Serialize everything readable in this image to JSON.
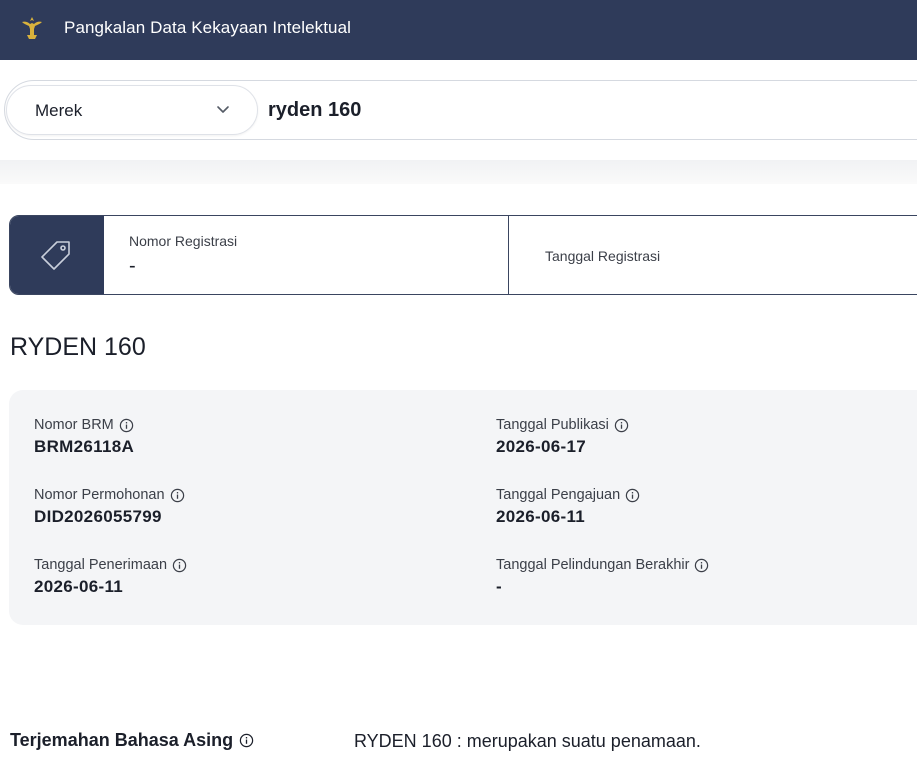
{
  "header": {
    "title": "Pangkalan Data Kekayaan Intelektual"
  },
  "search": {
    "category": "Merek",
    "query": "ryden 160"
  },
  "registration": {
    "number_label": "Nomor Registrasi",
    "number_value": "-",
    "date_label": "Tanggal Registrasi"
  },
  "mark_title": "RYDEN 160",
  "details": {
    "brm_label": "Nomor BRM",
    "brm_value": "BRM26118A",
    "application_label": "Nomor Permohonan",
    "application_value": "DID2026055799",
    "receipt_label": "Tanggal Penerimaan",
    "receipt_value": "2026-06-11",
    "publication_label": "Tanggal Publikasi",
    "publication_value": "2026-06-17",
    "filing_label": "Tanggal Pengajuan",
    "filing_value": "2026-06-11",
    "protection_end_label": "Tanggal Pelindungan Berakhir",
    "protection_end_value": "-"
  },
  "translation": {
    "label": "Terjemahan Bahasa Asing",
    "value": "RYDEN 160 : merupakan suatu penamaan."
  },
  "colors": {
    "navy": "#2f3b5a",
    "logo_gold": "#d9b23c",
    "panel_gray": "#f4f5f7"
  }
}
